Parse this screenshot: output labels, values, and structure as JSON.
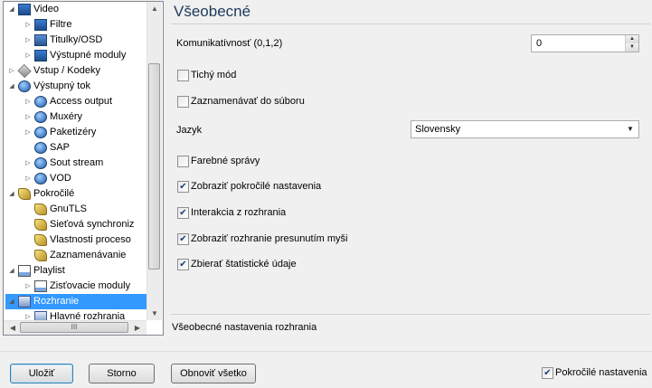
{
  "tree": {
    "items": [
      {
        "label": "Video",
        "expander": "◢",
        "icon": "film-icon",
        "iconClass": "film",
        "name": "tree-item-video"
      },
      {
        "label": "Filtre",
        "expander": "▷",
        "icon": "film-icon",
        "iconClass": "film",
        "name": "tree-item-filtre"
      },
      {
        "label": "Titulky/OSD",
        "expander": "▷",
        "icon": "subtitle-icon",
        "iconClass": "sub",
        "name": "tree-item-titulky-osd"
      },
      {
        "label": "Výstupné moduly",
        "expander": "▷",
        "icon": "film-icon",
        "iconClass": "film",
        "name": "tree-item-vystupne-moduly"
      },
      {
        "label": "Vstup / Kodeky",
        "expander": "▷",
        "icon": "plug-icon",
        "iconClass": "plug",
        "name": "tree-item-vstup-kodeky"
      },
      {
        "label": "Výstupný tok",
        "expander": "◢",
        "icon": "network-icon",
        "iconClass": "net",
        "name": "tree-item-vystupny-tok"
      },
      {
        "label": "Access output",
        "expander": "▷",
        "icon": "network-icon",
        "iconClass": "net",
        "name": "tree-item-access-output"
      },
      {
        "label": "Muxéry",
        "expander": "▷",
        "icon": "network-icon",
        "iconClass": "net",
        "name": "tree-item-muxery"
      },
      {
        "label": "Paketizéry",
        "expander": "▷",
        "icon": "network-icon",
        "iconClass": "net",
        "name": "tree-item-paketizery"
      },
      {
        "label": "SAP",
        "expander": "",
        "icon": "network-icon",
        "iconClass": "net",
        "name": "tree-item-sap"
      },
      {
        "label": "Sout stream",
        "expander": "▷",
        "icon": "network-icon",
        "iconClass": "net",
        "name": "tree-item-sout-stream"
      },
      {
        "label": "VOD",
        "expander": "▷",
        "icon": "network-icon",
        "iconClass": "net",
        "name": "tree-item-vod"
      },
      {
        "label": "Pokročilé",
        "expander": "◢",
        "icon": "wrench-icon",
        "iconClass": "wrench",
        "name": "tree-item-pokrocile"
      },
      {
        "label": "GnuTLS",
        "expander": "",
        "icon": "wrench-icon",
        "iconClass": "wrench",
        "name": "tree-item-gnutls"
      },
      {
        "label": "Sieťová synchroniz",
        "expander": "",
        "icon": "wrench-icon",
        "iconClass": "wrench",
        "name": "tree-item-sietova-synchronizacia"
      },
      {
        "label": "Vlastnosti proceso",
        "expander": "",
        "icon": "wrench-icon",
        "iconClass": "wrench",
        "name": "tree-item-vlastnosti-procesora"
      },
      {
        "label": "Zaznamenávanie",
        "expander": "",
        "icon": "wrench-icon",
        "iconClass": "wrench",
        "name": "tree-item-zaznamenavanie"
      },
      {
        "label": "Playlist",
        "expander": "◢",
        "icon": "playlist-icon",
        "iconClass": "doc",
        "name": "tree-item-playlist"
      },
      {
        "label": "Zisťovacie moduly",
        "expander": "▷",
        "icon": "playlist-icon",
        "iconClass": "doc",
        "name": "tree-item-zistovacie-moduly"
      },
      {
        "label": "Rozhranie",
        "expander": "◢",
        "icon": "interface-icon",
        "iconClass": "iface",
        "name": "tree-item-rozhranie",
        "selected": true
      },
      {
        "label": "Hlavné rozhrania",
        "expander": "▷",
        "icon": "interface-icon",
        "iconClass": "iface",
        "name": "tree-item-hlavne-rozhrania"
      }
    ],
    "hscroll_grip": "III"
  },
  "panel": {
    "title": "Všeobecné",
    "verbosity_label": "Komunikatívnosť (0,1,2)",
    "verbosity_value": "0",
    "quiet_label": "Tichý mód",
    "quiet_checked": false,
    "log_label": "Zaznamenávať do súboru",
    "log_checked": false,
    "language_label": "Jazyk",
    "language_value": "Slovensky",
    "color_label": "Farebné správy",
    "color_checked": false,
    "advanced_label": "Zobraziť pokročilé nastavenia",
    "advanced_checked": true,
    "interaction_label": "Interakcia z rozhrania",
    "interaction_checked": true,
    "mouse_label": "Zobraziť rozhranie presunutím myši",
    "mouse_checked": true,
    "stats_label": "Zbierať štatistické údaje",
    "stats_checked": true,
    "description": "Všeobecné nastavenia rozhrania"
  },
  "footer": {
    "save": "Uložiť",
    "cancel": "Storno",
    "reset": "Obnoviť všetko",
    "advanced_label": "Pokročilé nastavenia",
    "advanced_checked": true
  },
  "check_glyph": "✔",
  "colors": {
    "selection": "#3399ff",
    "title": "#1e395b"
  }
}
